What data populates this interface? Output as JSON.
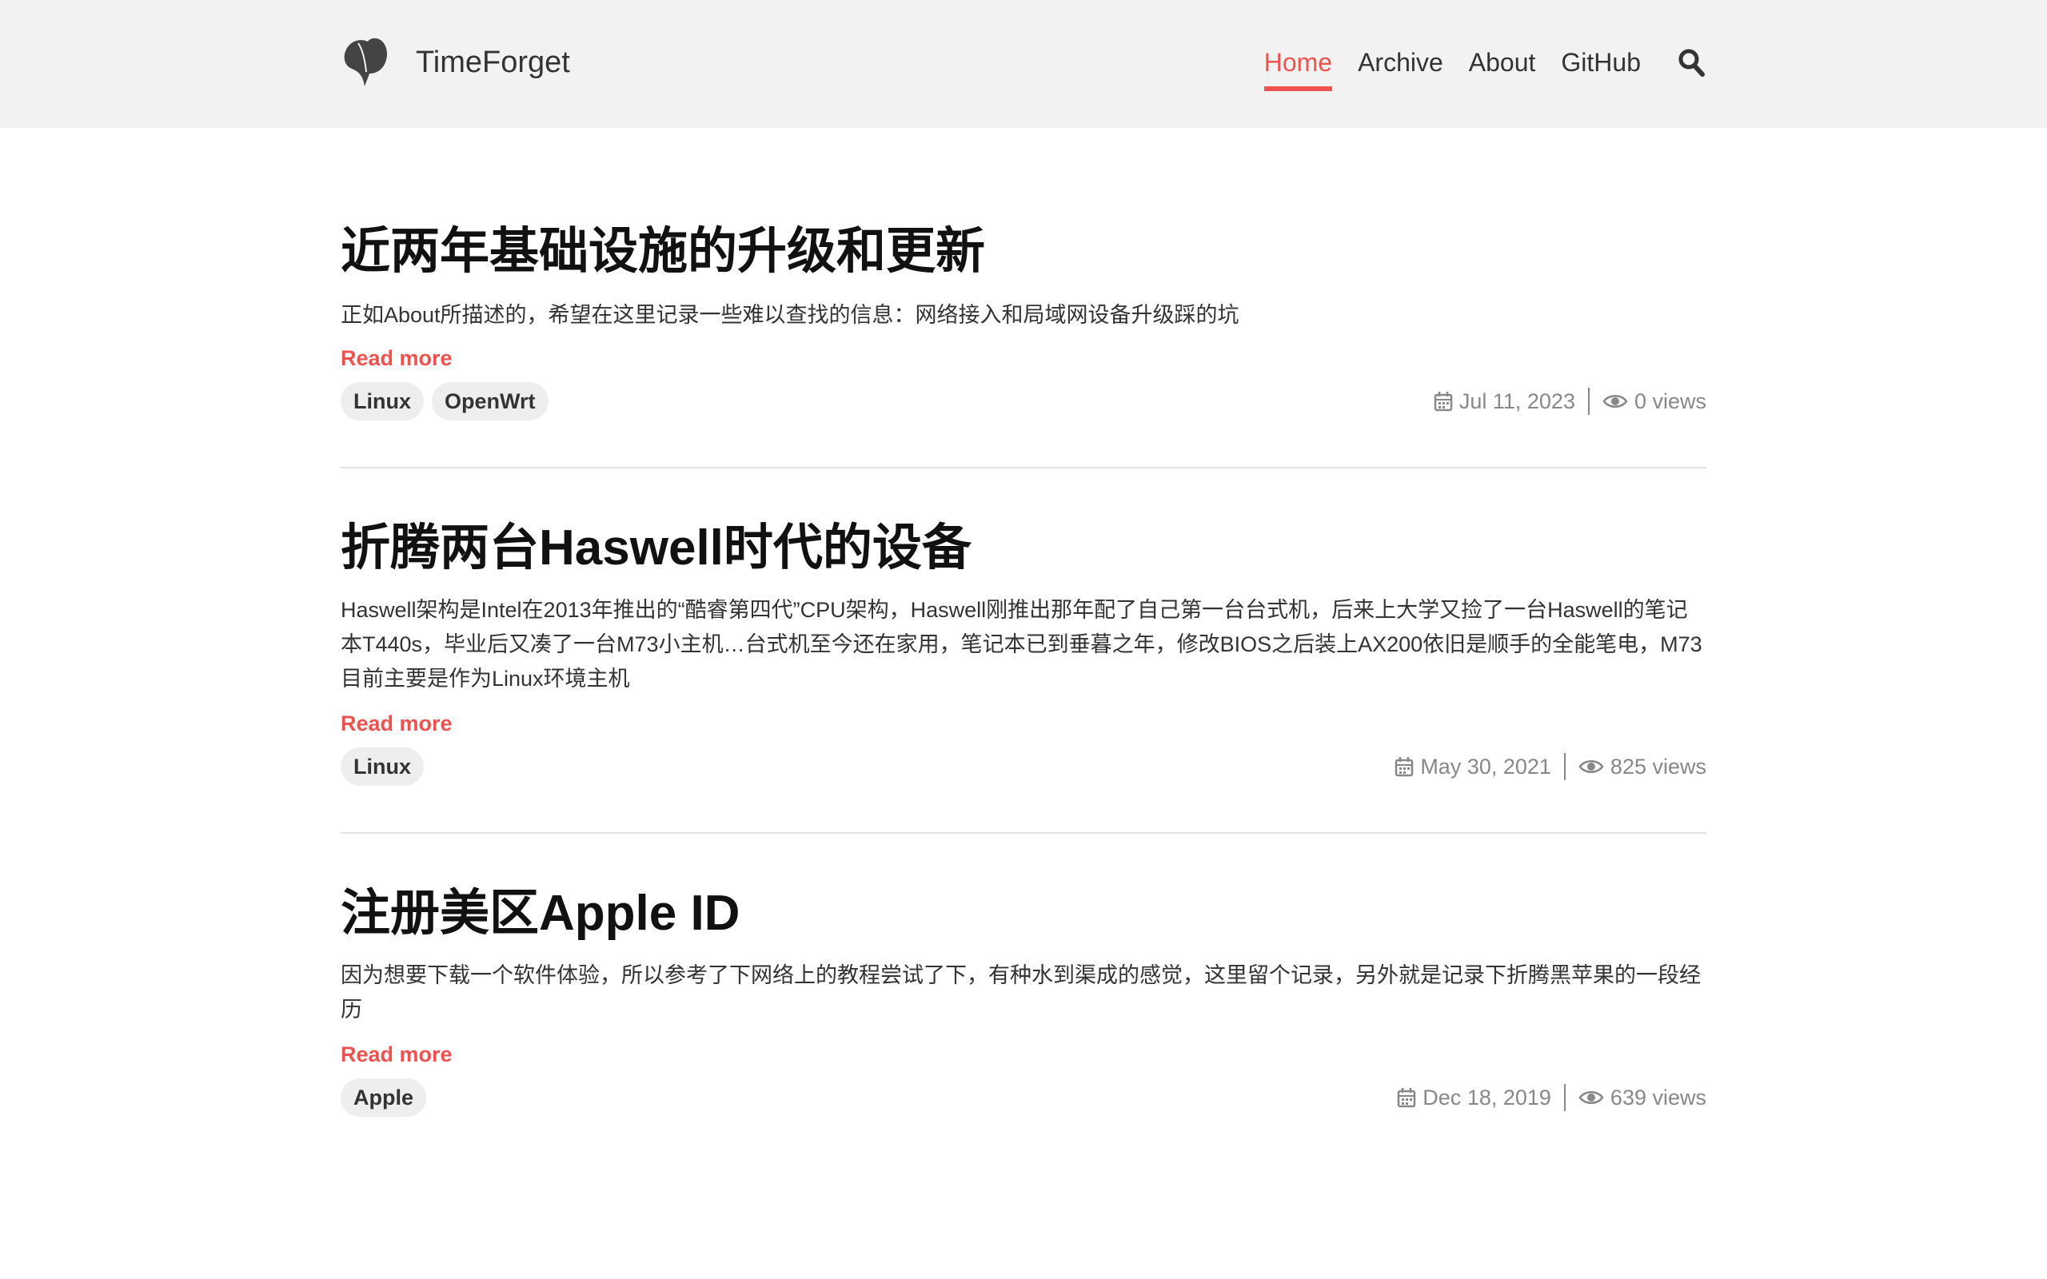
{
  "header": {
    "logo_icon": "ginkgo-leaf-icon",
    "site_title": "TimeForget",
    "nav": [
      {
        "label": "Home",
        "active": true
      },
      {
        "label": "Archive",
        "active": false
      },
      {
        "label": "About",
        "active": false
      },
      {
        "label": "GitHub",
        "active": false
      }
    ],
    "search_icon": "search-icon"
  },
  "colors": {
    "accent": "#ef5350",
    "header_bg": "#f2f2f2",
    "tag_bg": "#eeeeee",
    "meta_text": "#888888",
    "divider": "#e4e4e4"
  },
  "posts": [
    {
      "title": "近两年基础设施的升级和更新",
      "summary": "正如About所描述的，希望在这里记录一些难以查找的信息：网络接入和局域网设备升级踩的坑",
      "read_more": "Read more",
      "tags": [
        "Linux",
        "OpenWrt"
      ],
      "date": "Jul 11, 2023",
      "views": "0 views"
    },
    {
      "title": "折腾两台Haswell时代的设备",
      "summary": "Haswell架构是Intel在2013年推出的“酷睿第四代”CPU架构，Haswell刚推出那年配了自己第一台台式机，后来上大学又捡了一台Haswell的笔记本T440s，毕业后又凑了一台M73小主机…台式机至今还在家用，笔记本已到垂暮之年，修改BIOS之后装上AX200依旧是顺手的全能笔电，M73目前主要是作为Linux环境主机",
      "read_more": "Read more",
      "tags": [
        "Linux"
      ],
      "date": "May 30, 2021",
      "views": "825 views"
    },
    {
      "title": "注册美区Apple ID",
      "summary": "因为想要下载一个软件体验，所以参考了下网络上的教程尝试了下，有种水到渠成的感觉，这里留个记录，另外就是记录下折腾黑苹果的一段经历",
      "read_more": "Read more",
      "tags": [
        "Apple"
      ],
      "date": "Dec 18, 2019",
      "views": "639 views"
    }
  ]
}
